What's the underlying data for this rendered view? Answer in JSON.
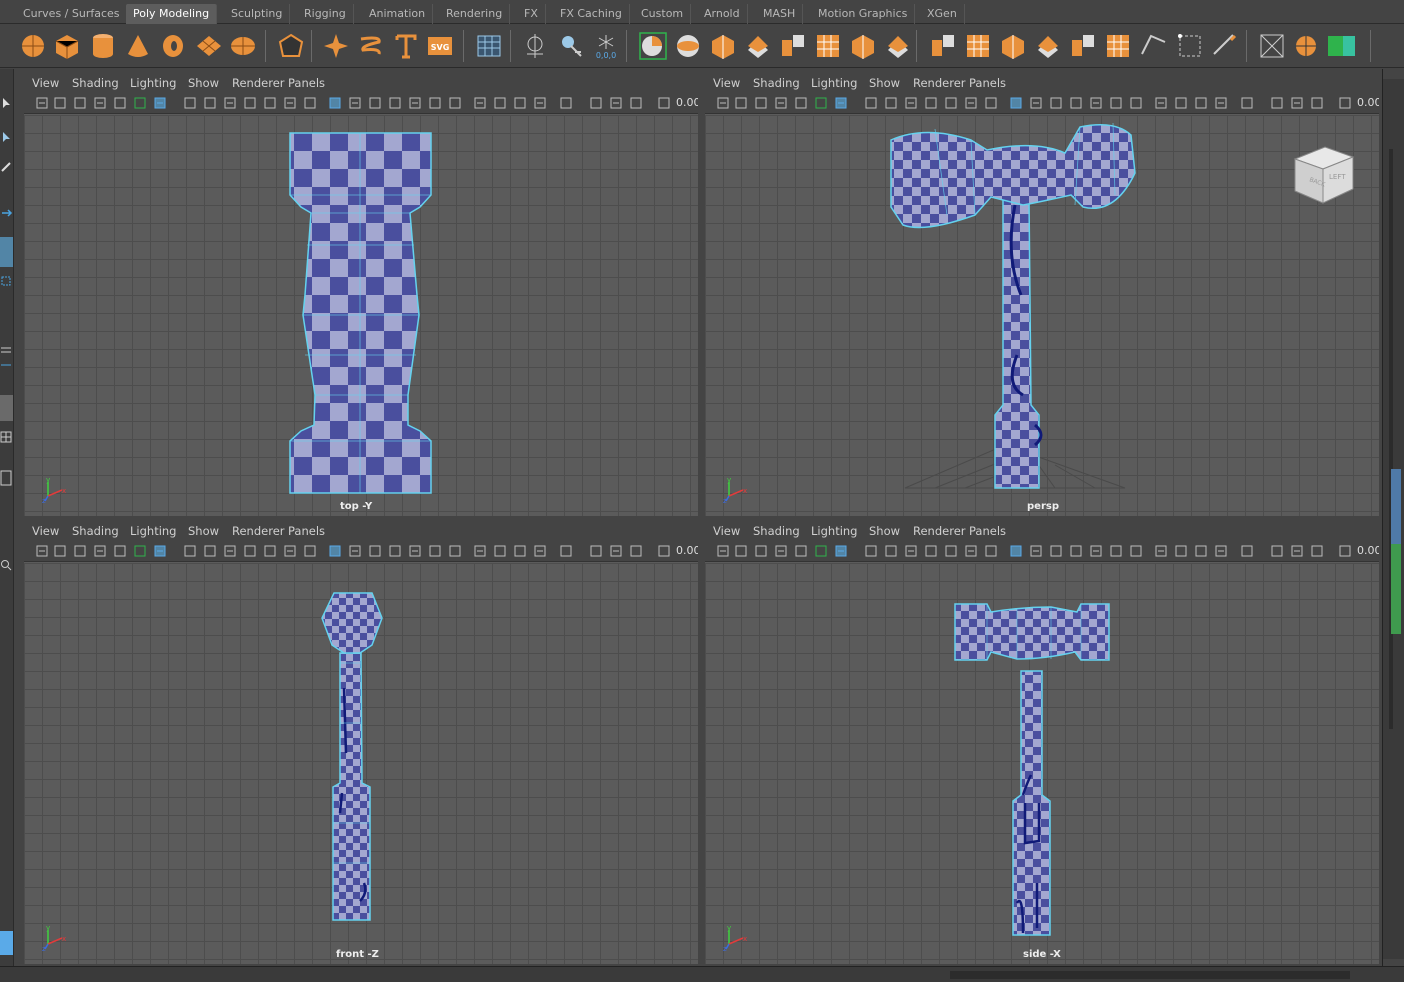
{
  "shelf": {
    "tabs": [
      "Curves / Surfaces",
      "Poly Modeling",
      "Sculpting",
      "Rigging",
      "Animation",
      "Rendering",
      "FX",
      "FX Caching",
      "Custom",
      "Arnold",
      "MASH",
      "Motion Graphics",
      "XGen"
    ],
    "active_tab": "Poly Modeling",
    "icons": [
      "sphere-icon",
      "cube-icon",
      "cylinder-icon",
      "cone-icon",
      "torus-icon",
      "plane-icon",
      "disc-icon",
      "platonic-icon",
      "star-icon",
      "spring-icon",
      "text-icon",
      "svg-icon",
      "grid-icon",
      "mirror-icon",
      "snap-icon",
      "snow-icon",
      "combine-icon",
      "separate-icon",
      "smooth-icon",
      "bevel-icon",
      "extrude-icon",
      "bridge-icon",
      "fill-hole-icon",
      "merge-icon",
      "multi-cut-icon",
      "insert-loop-icon",
      "offset-loop-icon",
      "boolean-icon",
      "reduce-icon",
      "target-weld-icon",
      "connect-icon",
      "quad-draw-icon",
      "sew-icon",
      "cut-uv-icon",
      "unfold-icon",
      "layout-icon"
    ],
    "svg_label": "SVG",
    "snap_label": "0,0,0"
  },
  "viewport_menu": [
    "View",
    "Shading",
    "Lighting",
    "Show",
    "Renderer",
    "Panels"
  ],
  "zoom_value": "0.00",
  "viewports": [
    {
      "name": "top",
      "label": "top -Y"
    },
    {
      "name": "persp",
      "label": "persp"
    },
    {
      "name": "front",
      "label": "front -Z"
    },
    {
      "name": "side",
      "label": "side -X"
    }
  ],
  "view_cube": {
    "face_left": "LEFT",
    "face_back": "BACK"
  },
  "colors": {
    "accent": "#5285a6",
    "checker_light": "#a3a7d0",
    "checker_dark": "#4a4f9e",
    "wire": "#64d2ee",
    "icon_orange": "#e8913c"
  }
}
